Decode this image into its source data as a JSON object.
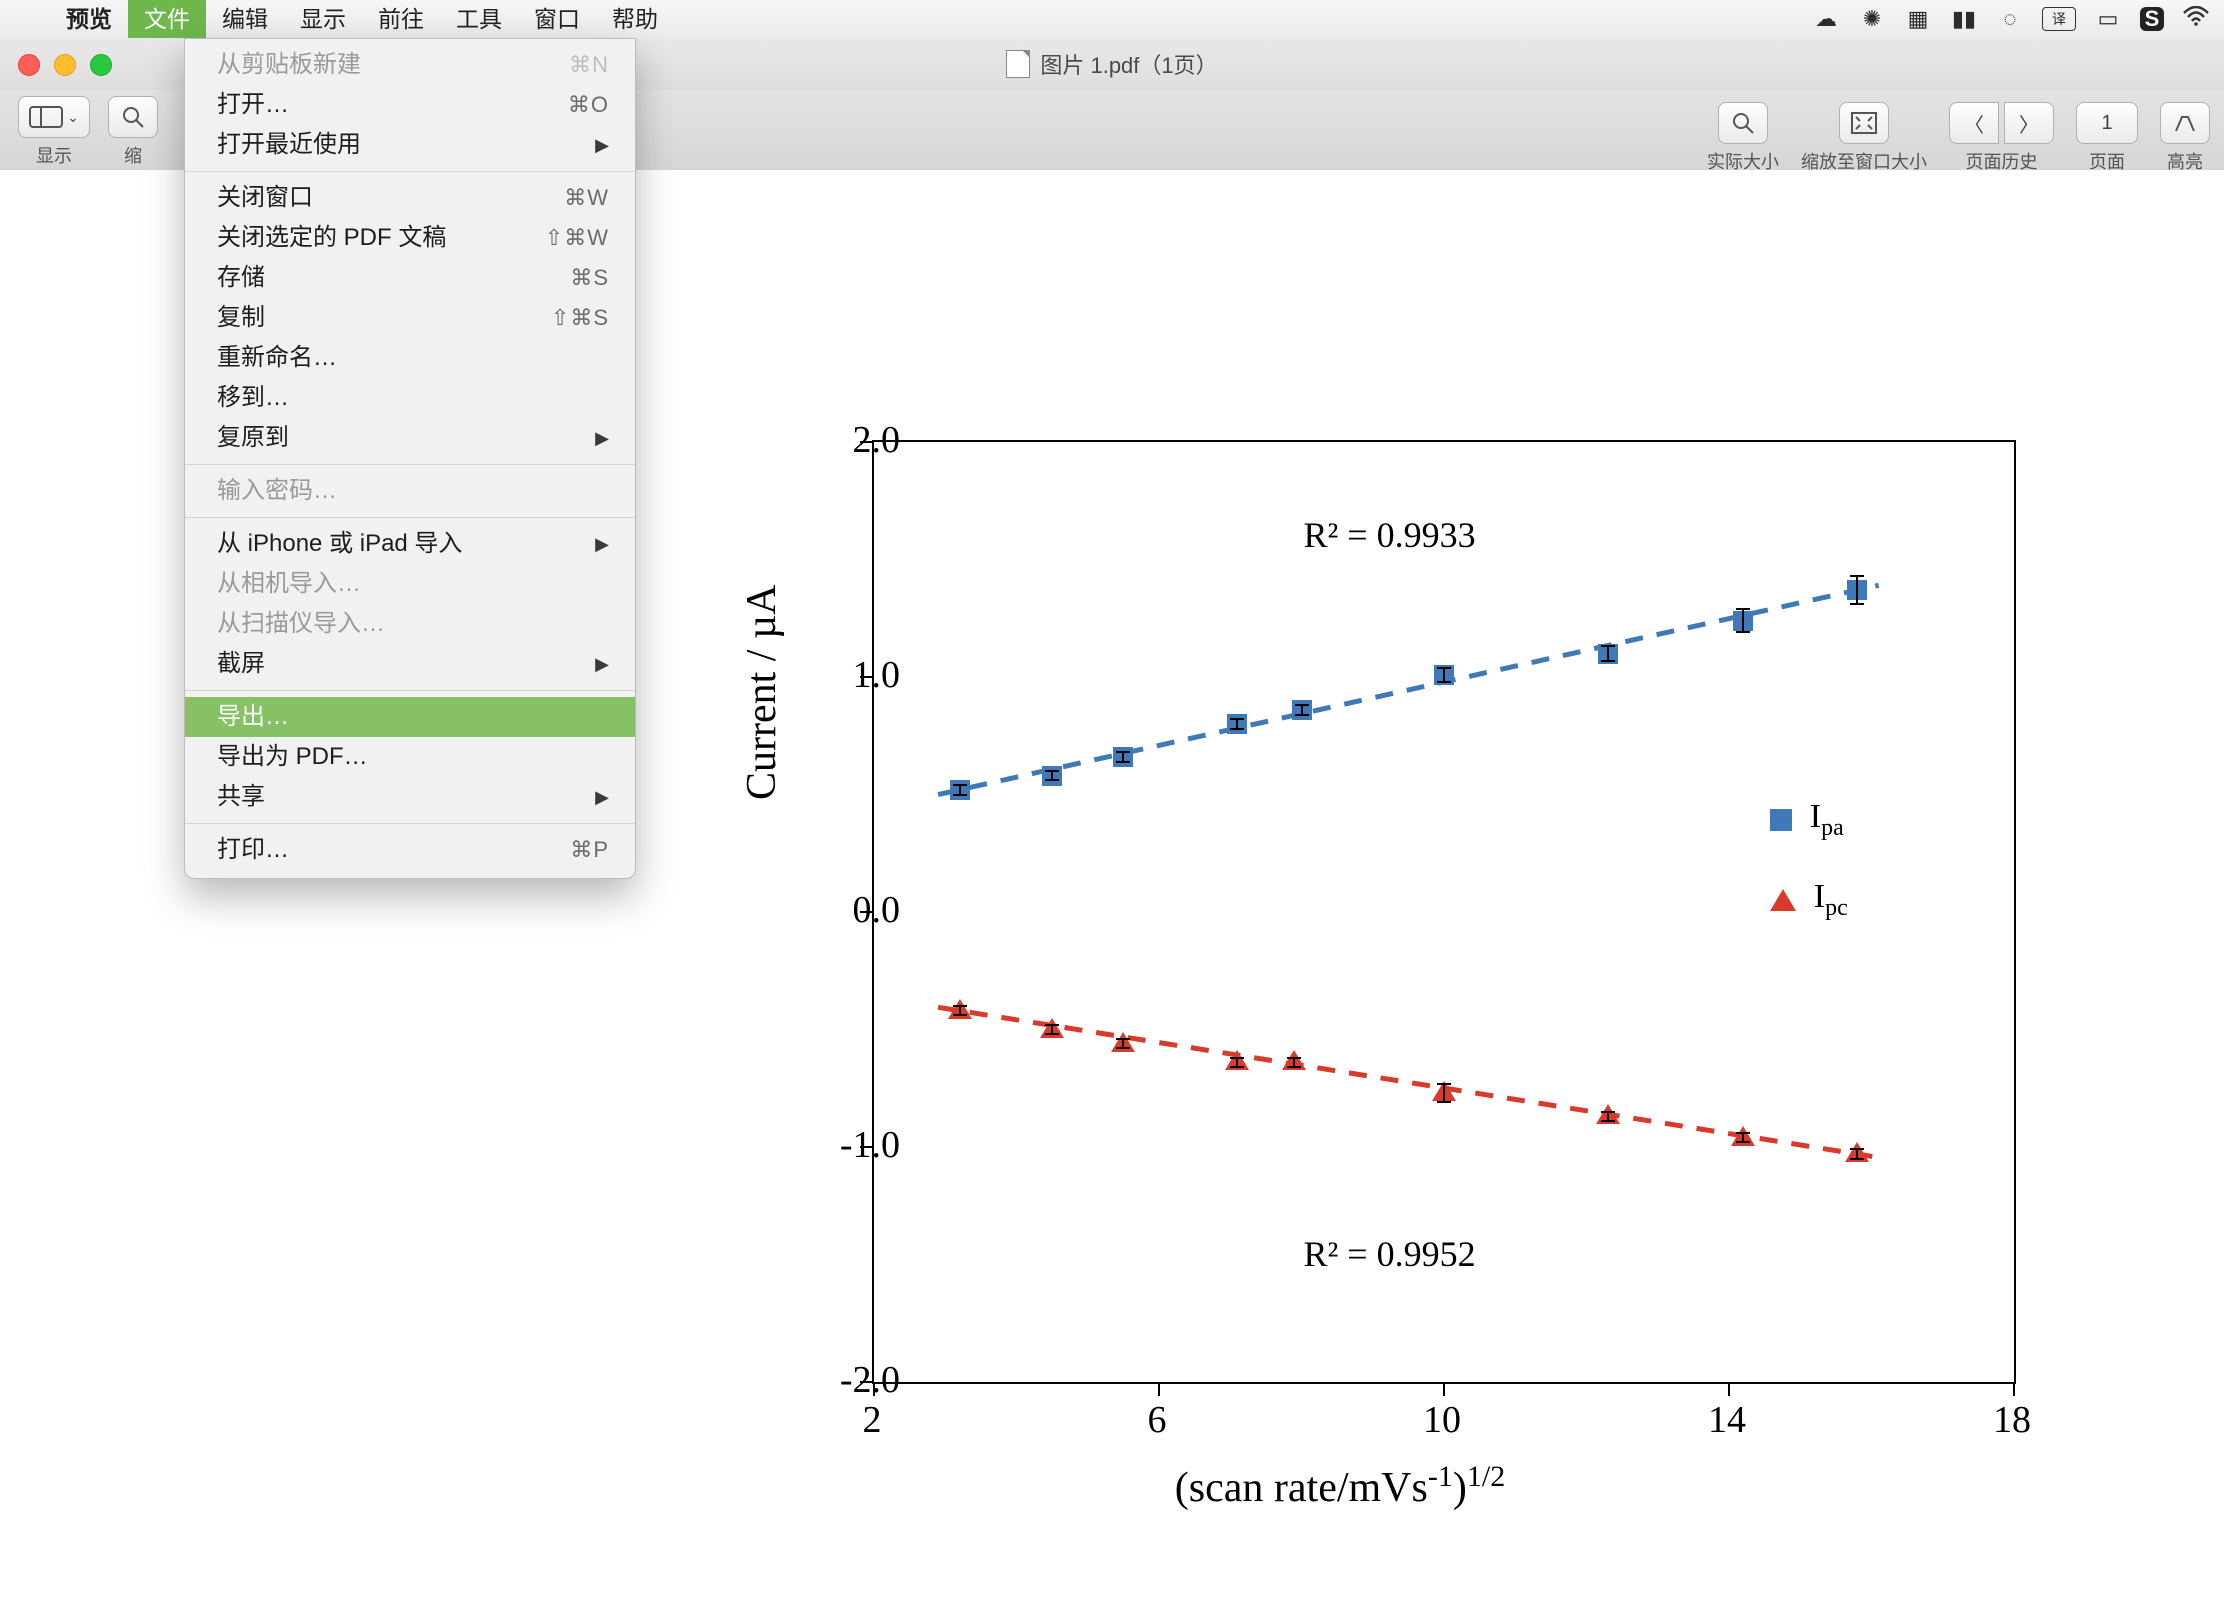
{
  "menubar": {
    "app": "预览",
    "items": [
      "文件",
      "编辑",
      "显示",
      "前往",
      "工具",
      "窗口",
      "帮助"
    ],
    "active_index": 0
  },
  "window": {
    "title": "图片 1.pdf（1页）"
  },
  "toolbar": {
    "left": [
      {
        "icon": "sidebar",
        "label": "显示"
      },
      {
        "icon": "zoom",
        "label": "缩"
      }
    ],
    "right": [
      {
        "icon": "magnifier",
        "label": "实际大小"
      },
      {
        "icon": "fit",
        "label": "缩放至窗口大小"
      },
      {
        "icon": "history",
        "label": "页面历史",
        "double": true
      },
      {
        "icon": "page",
        "label": "页面",
        "text": "1"
      },
      {
        "icon": "highlight",
        "label": "高亮"
      }
    ]
  },
  "dropdown": {
    "groups": [
      [
        {
          "label": "从剪贴板新建",
          "shortcut": "⌘N",
          "disabled": true
        },
        {
          "label": "打开…",
          "shortcut": "⌘O"
        },
        {
          "label": "打开最近使用",
          "arrow": true
        }
      ],
      [
        {
          "label": "关闭窗口",
          "shortcut": "⌘W"
        },
        {
          "label": "关闭选定的 PDF 文稿",
          "shortcut": "⇧⌘W"
        },
        {
          "label": "存储",
          "shortcut": "⌘S"
        },
        {
          "label": "复制",
          "shortcut": "⇧⌘S"
        },
        {
          "label": "重新命名…"
        },
        {
          "label": "移到…"
        },
        {
          "label": "复原到",
          "arrow": true
        }
      ],
      [
        {
          "label": "输入密码…",
          "disabled": true
        }
      ],
      [
        {
          "label": "从 iPhone 或 iPad 导入",
          "arrow": true
        },
        {
          "label": "从相机导入…",
          "disabled": true
        },
        {
          "label": "从扫描仪导入…",
          "disabled": true
        },
        {
          "label": "截屏",
          "arrow": true
        }
      ],
      [
        {
          "label": "导出…",
          "highlight": true
        },
        {
          "label": "导出为 PDF…"
        },
        {
          "label": "共享",
          "arrow": true
        }
      ],
      [
        {
          "label": "打印…",
          "shortcut": "⌘P"
        }
      ]
    ]
  },
  "chart_data": {
    "type": "scatter",
    "xlabel": "(scan rate/mVs⁻¹)¹ᐟ²",
    "ylabel": "Current / µA",
    "xlim": [
      2,
      18
    ],
    "ylim": [
      -2.0,
      2.0
    ],
    "xticks": [
      2,
      6,
      10,
      14,
      18
    ],
    "yticks": [
      -2.0,
      -1.0,
      0.0,
      1.0,
      2.0
    ],
    "series": [
      {
        "name": "Iₚₐ",
        "marker": "square",
        "color": "#3f79b7",
        "r2_label": "R² = 0.9933",
        "x": [
          3.2,
          4.5,
          5.5,
          7.1,
          8.0,
          10.0,
          12.3,
          14.2,
          15.8
        ],
        "y": [
          0.52,
          0.58,
          0.66,
          0.8,
          0.86,
          1.01,
          1.1,
          1.24,
          1.37
        ],
        "yerr": [
          0.02,
          0.02,
          0.02,
          0.02,
          0.02,
          0.03,
          0.03,
          0.05,
          0.06
        ]
      },
      {
        "name": "Iₚ꜀",
        "marker": "triangle",
        "color": "#d93a2b",
        "r2_label": "R² = 0.9952",
        "x": [
          3.2,
          4.5,
          5.5,
          7.1,
          7.9,
          10.0,
          12.3,
          14.2,
          15.8
        ],
        "y": [
          -0.42,
          -0.5,
          -0.56,
          -0.64,
          -0.64,
          -0.77,
          -0.87,
          -0.96,
          -1.03
        ],
        "yerr": [
          0.02,
          0.02,
          0.02,
          0.02,
          0.02,
          0.04,
          0.02,
          0.02,
          0.02
        ]
      }
    ],
    "annotations": [
      {
        "text": "R² = 0.9933",
        "x": 9.6,
        "y": 1.6
      },
      {
        "text": "R² = 0.9952",
        "x": 9.6,
        "y": -1.46
      }
    ],
    "legend": [
      {
        "name": "Iₚₐ",
        "marker": "square"
      },
      {
        "name": "Iₚ꜀",
        "marker": "triangle"
      }
    ]
  }
}
